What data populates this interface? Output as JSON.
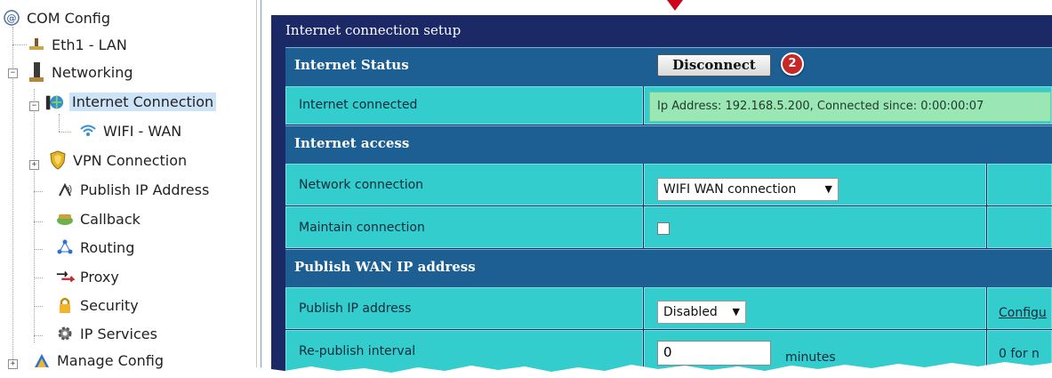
{
  "sidebar": {
    "root": "COM Config",
    "items": [
      {
        "label": "Eth1 - LAN",
        "icon": "network-plug-icon"
      },
      {
        "label": "Networking",
        "icon": "networking-icon"
      },
      {
        "label": "Internet Connection",
        "icon": "internet-connection-icon"
      },
      {
        "label": "WIFI - WAN",
        "icon": "wifi-icon"
      },
      {
        "label": "VPN Connection",
        "icon": "vpn-shield-icon"
      },
      {
        "label": "Publish IP Address",
        "icon": "publish-ip-icon"
      },
      {
        "label": "Callback",
        "icon": "callback-icon"
      },
      {
        "label": "Routing",
        "icon": "routing-icon"
      },
      {
        "label": "Proxy",
        "icon": "proxy-icon"
      },
      {
        "label": "Security",
        "icon": "lock-icon"
      },
      {
        "label": "IP Services",
        "icon": "gear-icon"
      },
      {
        "label": "Manage Config",
        "icon": "manage-config-icon"
      }
    ],
    "selected": "Internet Connection"
  },
  "panel": {
    "title": "Internet connection setup",
    "status_label": "Internet Status",
    "disconnect_label": "Disconnect",
    "callout_number": "2",
    "connected_label": "Internet connected",
    "ip_info": "Ip Address: 192.168.5.200, Connected since: 0:00:00:07",
    "access_section": "Internet access",
    "network_connection_label": "Network connection",
    "network_connection_value": "WIFI WAN connection",
    "maintain_label": "Maintain connection",
    "maintain_checked": false,
    "publish_section": "Publish WAN IP address",
    "publish_label": "Publish IP address",
    "publish_value": "Disabled",
    "configure_link": "Configu",
    "republish_label": "Re-publish interval",
    "republish_value": "0",
    "republish_unit": "minutes",
    "republish_hint": "0 for n"
  },
  "colors": {
    "panel_bg": "#1b2a66",
    "section_bg": "#1d5f93",
    "cell_bg": "#33cdcd",
    "ip_box_bg": "#9ae6b4",
    "callout_red": "#c62828"
  }
}
